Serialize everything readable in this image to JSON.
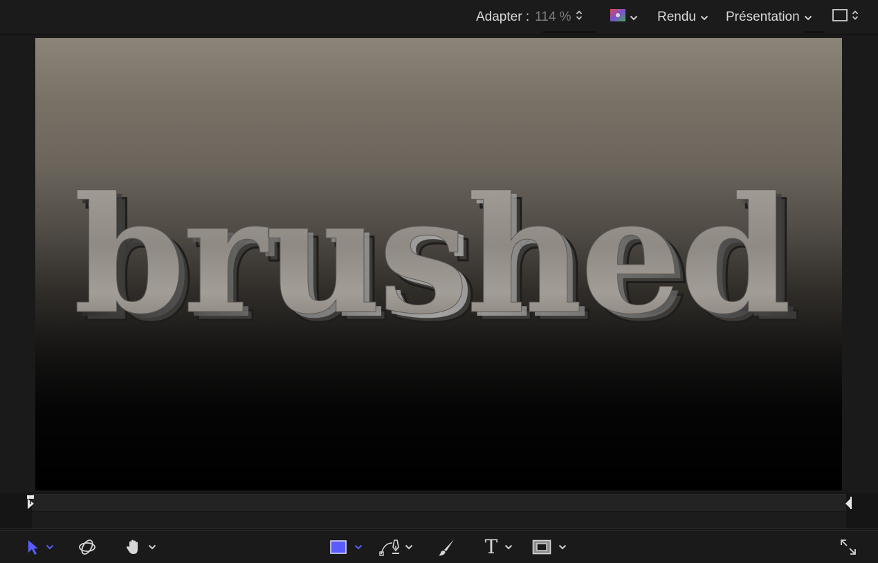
{
  "header": {
    "fit_label": "Adapter :",
    "zoom_value": "114 %",
    "render_label": "Rendu",
    "view_label": "Présentation"
  },
  "canvas": {
    "text": "brushed"
  },
  "toolbar": {
    "tools": [
      {
        "icon": "arrow-select-icon"
      },
      {
        "icon": "3d-transform-icon"
      },
      {
        "icon": "hand-pan-icon"
      },
      {
        "icon": "rectangle-shape-icon"
      },
      {
        "icon": "pen-bezier-icon"
      },
      {
        "icon": "paint-brush-icon"
      },
      {
        "icon": "text-tool-icon"
      },
      {
        "icon": "mask-rectangle-icon"
      },
      {
        "icon": "expand-icon"
      }
    ],
    "text_tool_glyph": "T"
  },
  "colors": {
    "accent": "#5b5bff",
    "text": "#d9d9d9",
    "muted": "#7d7d7d"
  }
}
